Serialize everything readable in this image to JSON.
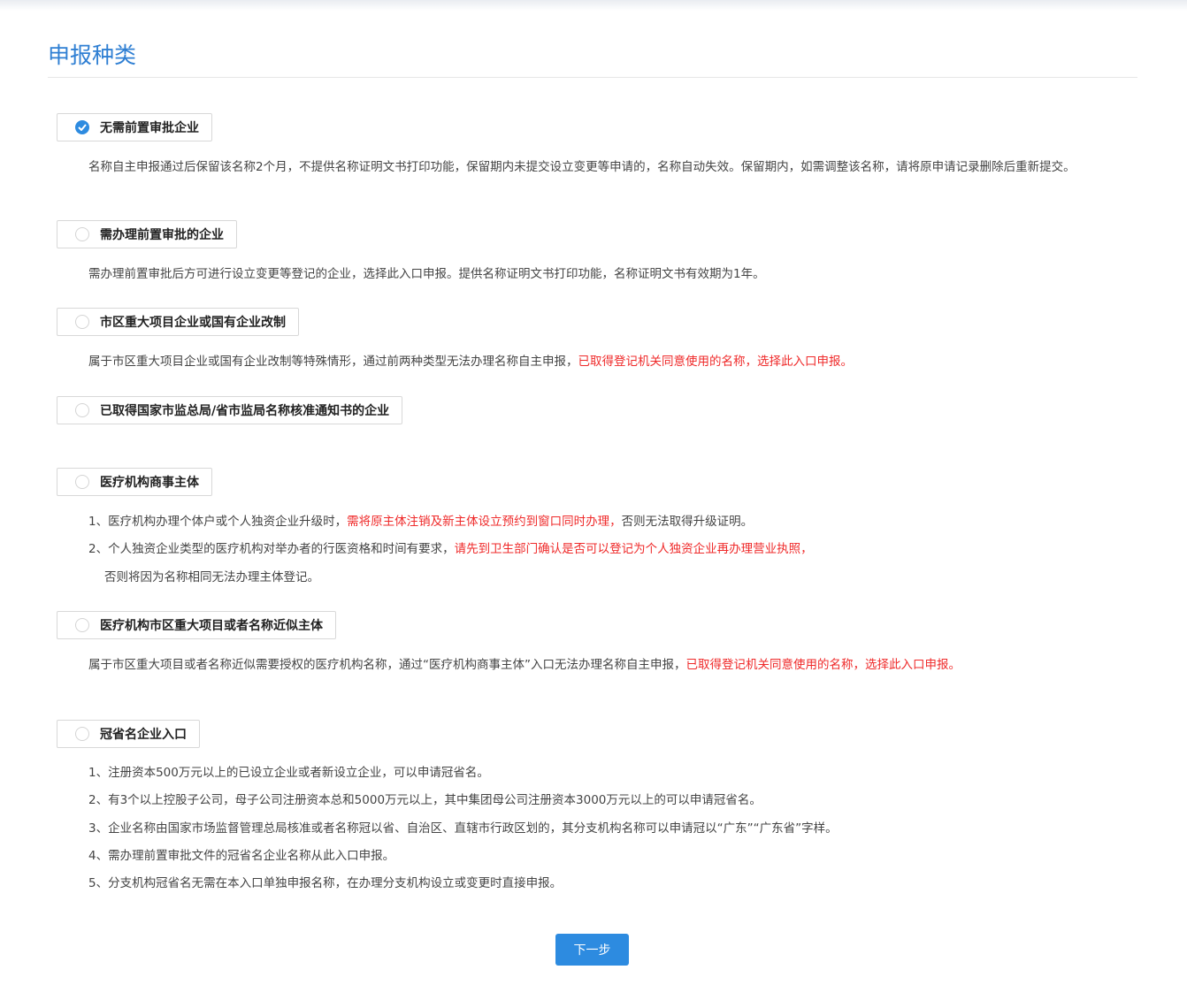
{
  "page": {
    "title": "申报种类"
  },
  "options": [
    {
      "label": "无需前置审批企业",
      "checked": true
    },
    {
      "label": "需办理前置审批的企业",
      "checked": false
    },
    {
      "label": "市区重大项目企业或国有企业改制",
      "checked": false
    },
    {
      "label": "已取得国家市监总局/省市监局名称核准通知书的企业",
      "checked": false
    },
    {
      "label": "医疗机构商事主体",
      "checked": false
    },
    {
      "label": "医疗机构市区重大项目或者名称近似主体",
      "checked": false
    },
    {
      "label": "冠省名企业入口",
      "checked": false
    }
  ],
  "desc": {
    "o1": "名称自主申报通过后保留该名称2个月，不提供名称证明文书打印功能，保留期内未提交设立变更等申请的，名称自动失效。保留期内，如需调整该名称，请将原申请记录删除后重新提交。",
    "o2": "需办理前置审批后方可进行设立变更等登记的企业，选择此入口申报。提供名称证明文书打印功能，名称证明文书有效期为1年。",
    "o3_a": "属于市区重大项目企业或国有企业改制等特殊情形，通过前两种类型无法办理名称自主申报，",
    "o3_b": "已取得登记机关同意使用的名称，选择此入口申报。",
    "o5_1a": "1、医疗机构办理个体户或个人独资企业升级时，",
    "o5_1b": "需将原主体注销及新主体设立预约到窗口同时办理，",
    "o5_1c": "否则无法取得升级证明。",
    "o5_2a": "2、个人独资企业类型的医疗机构对举办者的行医资格和时间有要求，",
    "o5_2b": "请先到卫生部门确认是否可以登记为个人独资企业再办理营业执照，",
    "o5_2c": "否则将因为名称相同无法办理主体登记。",
    "o6_a": "属于市区重大项目或者名称近似需要授权的医疗机构名称，通过“医疗机构商事主体”入口无法办理名称自主申报，",
    "o6_b": "已取得登记机关同意使用的名称，选择此入口申报。",
    "o7": [
      "1、注册资本500万元以上的已设立企业或者新设立企业，可以申请冠省名。",
      "2、有3个以上控股子公司，母子公司注册资本总和5000万元以上，其中集团母公司注册资本3000万元以上的可以申请冠省名。",
      "3、企业名称由国家市场监督管理总局核准或者名称冠以省、自治区、直辖市行政区划的，其分支机构名称可以申请冠以“广东”“广东省”字样。",
      "4、需办理前置审批文件的冠省名企业名称从此入口申报。",
      "5、分支机构冠省名无需在本入口单独申报名称，在办理分支机构设立或变更时直接申报。"
    ]
  },
  "buttons": {
    "next": "下一步"
  },
  "colors": {
    "accent": "#2d8be0",
    "title": "#2f7fd3",
    "warning": "#ef2a2a"
  }
}
